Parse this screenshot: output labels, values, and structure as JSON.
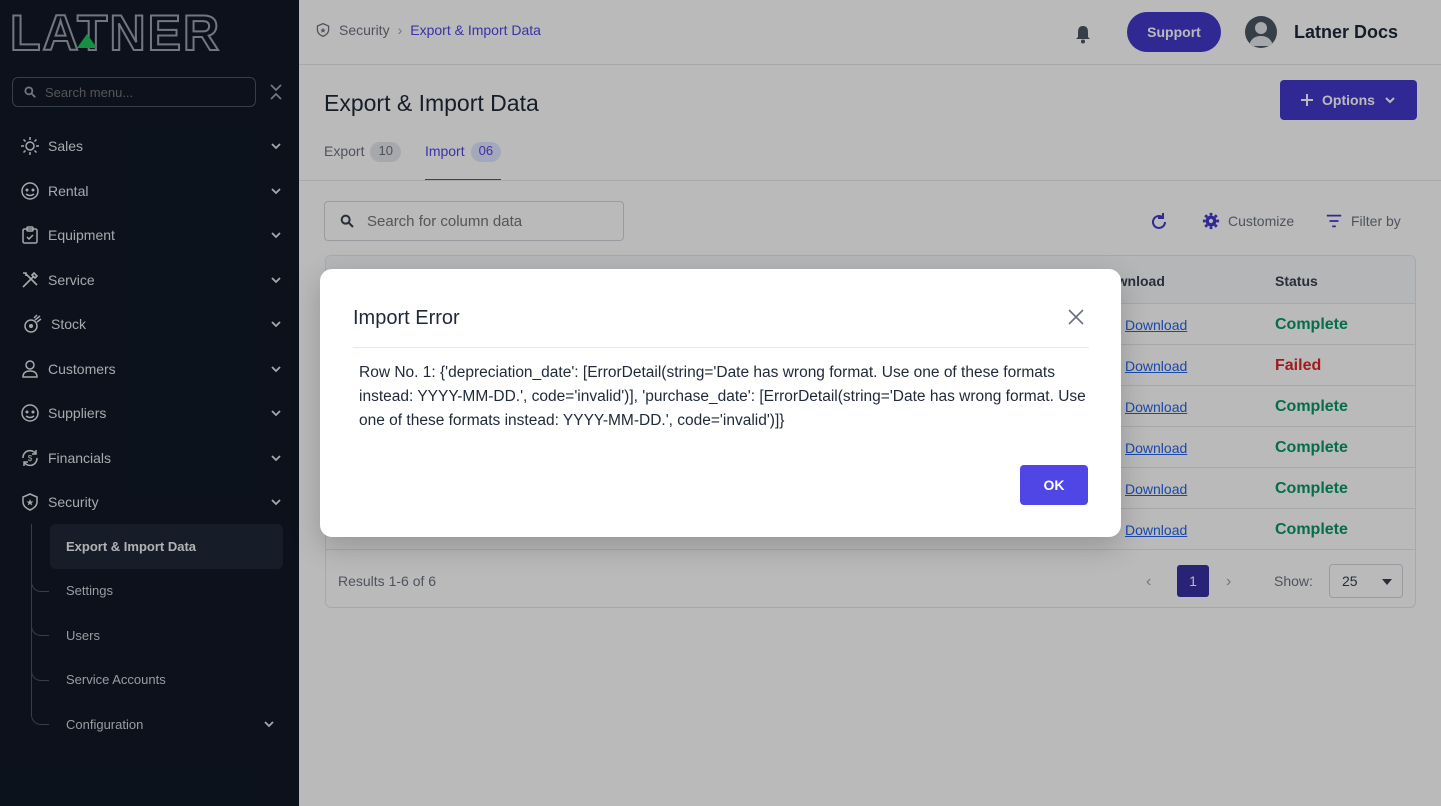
{
  "sidebar": {
    "logo_text": "LATNER",
    "search_placeholder": "Search menu...",
    "items": [
      {
        "label": "Sales"
      },
      {
        "label": "Rental"
      },
      {
        "label": "Equipment"
      },
      {
        "label": "Service"
      },
      {
        "label": "Stock"
      },
      {
        "label": "Customers"
      },
      {
        "label": "Suppliers"
      },
      {
        "label": "Financials"
      },
      {
        "label": "Security"
      }
    ],
    "sub_items": [
      {
        "label": "Export & Import Data"
      },
      {
        "label": "Settings"
      },
      {
        "label": "Users"
      },
      {
        "label": "Service Accounts"
      },
      {
        "label": "Configuration"
      }
    ]
  },
  "header": {
    "breadcrumb": [
      "Security",
      "Export & Import Data"
    ],
    "support_label": "Support",
    "user_name": "Latner Docs"
  },
  "main": {
    "title": "Export & Import Data",
    "options_label": "Options",
    "tabs": [
      {
        "label": "Export",
        "count": "10"
      },
      {
        "label": "Import",
        "count": "06"
      }
    ],
    "search_placeholder": "Search for column data",
    "customize_label": "Customize",
    "filter_label": "Filter by",
    "columns": {
      "download": "Download",
      "status": "Status"
    },
    "rows": [
      {
        "download": "Download",
        "status": "Complete"
      },
      {
        "download": "Download",
        "status": "Failed"
      },
      {
        "download": "Download",
        "status": "Complete"
      },
      {
        "download": "Download",
        "status": "Complete"
      },
      {
        "download": "Download",
        "status": "Complete"
      },
      {
        "download": "Download",
        "status": "Complete"
      }
    ],
    "results_text": "Results 1-6 of 6",
    "page": "1",
    "show_label": "Show:",
    "show_value": "25"
  },
  "modal": {
    "title": "Import Error",
    "message": "Row No. 1: {'depreciation_date': [ErrorDetail(string='Date has wrong format. Use one of these formats instead: YYYY-MM-DD.', code='invalid')], 'purchase_date': [ErrorDetail(string='Date has wrong format. Use one of these formats instead: YYYY-MM-DD.', code='invalid')]}",
    "ok_label": "OK"
  },
  "colors": {
    "sidebar_bg": "#111827",
    "accent": "#4338ca",
    "status_complete": "#059669",
    "status_failed": "#dc2626"
  }
}
